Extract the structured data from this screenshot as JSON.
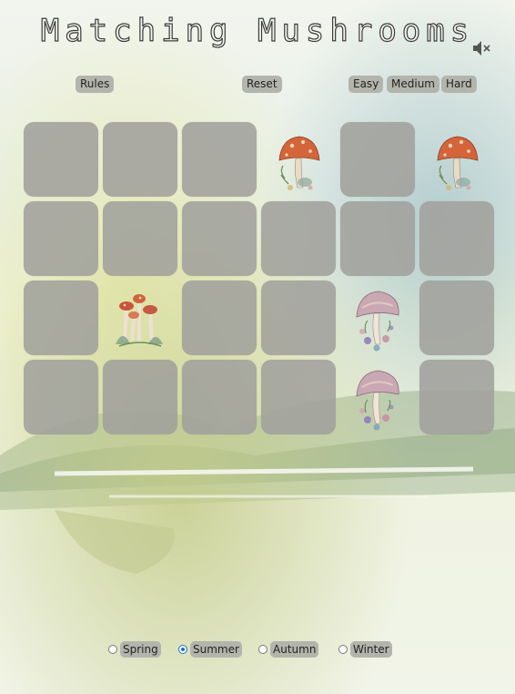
{
  "title": "Matching Mushrooms",
  "controls": {
    "mute_icon": "speaker-muted-icon",
    "rules_label": "Rules",
    "reset_label": "Reset",
    "easy_label": "Easy",
    "medium_label": "Medium",
    "hard_label": "Hard"
  },
  "board": {
    "rows": 4,
    "cols": 6,
    "cards": [
      [
        "hidden",
        "hidden",
        "hidden",
        "red-mushroom",
        "hidden",
        "red-mushroom"
      ],
      [
        "hidden",
        "hidden",
        "hidden",
        "hidden",
        "hidden",
        "hidden"
      ],
      [
        "hidden",
        "mushroom-cluster",
        "hidden",
        "hidden",
        "purple-mushroom",
        "hidden"
      ],
      [
        "hidden",
        "hidden",
        "hidden",
        "hidden",
        "purple-mushroom",
        "hidden"
      ]
    ]
  },
  "seasons": {
    "options": [
      "Spring",
      "Summer",
      "Autumn",
      "Winter"
    ],
    "selected": "Summer"
  },
  "colors": {
    "card_back": "#a0a09c",
    "pill": "#b3b5ad",
    "radio_selected": "#1a6fd6"
  }
}
